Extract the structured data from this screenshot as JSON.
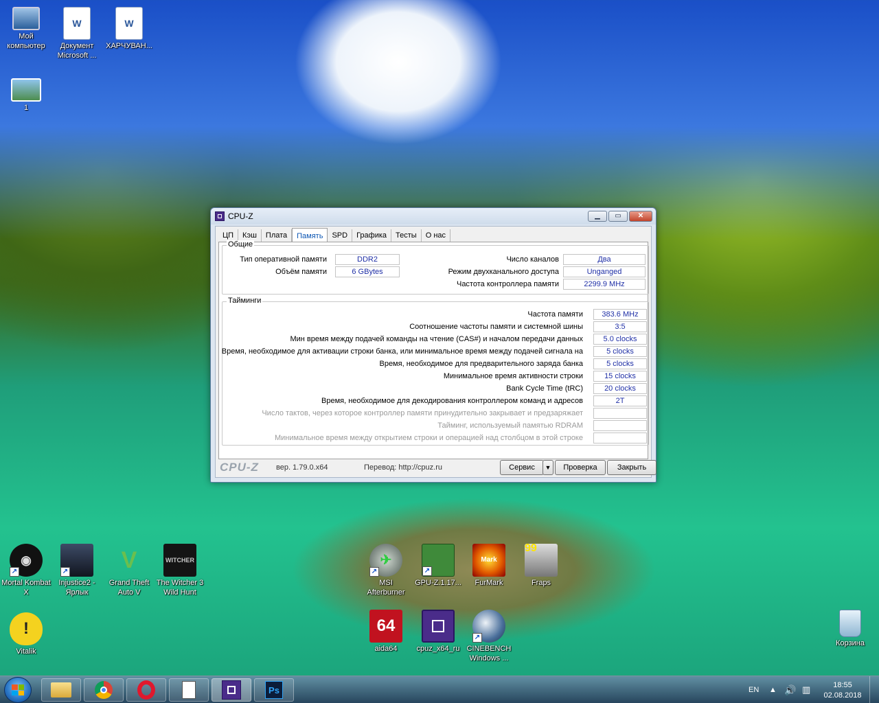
{
  "desktop": {
    "top_icons": [
      {
        "label": "Мой компьютер"
      },
      {
        "label": "Документ Microsoft ..."
      },
      {
        "label": "ХАРЧУВАН..."
      },
      {
        "label": "1"
      }
    ],
    "bottom_icons": [
      {
        "label": "Mortal Kombat X"
      },
      {
        "label": "Injustice2 - Ярлык"
      },
      {
        "label": "Grand Theft Auto V"
      },
      {
        "label": "The Witcher 3 Wild Hunt"
      },
      {
        "label": "MSI Afterburner"
      },
      {
        "label": "GPU-Z.1.17..."
      },
      {
        "label": "FurMark"
      },
      {
        "label": "Fraps"
      },
      {
        "label": "Vitalik"
      },
      {
        "label": "aida64"
      },
      {
        "label": "cpuz_x64_ru"
      },
      {
        "label": "CINEBENCH Windows ..."
      },
      {
        "label": "Корзина"
      }
    ],
    "icon_glyphs": {
      "aida": "64",
      "fraps": "99",
      "gta": "V",
      "witcher": "WITCHER",
      "furmark": "Mark",
      "photoshop": "Ps"
    }
  },
  "cpuz": {
    "title": "CPU-Z",
    "tabs": [
      "ЦП",
      "Кэш",
      "Плата",
      "Память",
      "SPD",
      "Графика",
      "Тесты",
      "О нас"
    ],
    "active_tab": "Память",
    "general": {
      "title": "Общие",
      "rows": [
        {
          "label": "Тип оперативной памяти",
          "value": "DDR2"
        },
        {
          "label": "Объём памяти",
          "value": "6 GBytes"
        },
        {
          "label": "Число каналов",
          "value": "Два"
        },
        {
          "label": "Режим двухканального доступа",
          "value": "Unganged"
        },
        {
          "label": "Частота контроллера памяти",
          "value": "2299.9 MHz"
        }
      ]
    },
    "timings": {
      "title": "Тайминги",
      "rows": [
        {
          "label": "Частота памяти",
          "value": "383.6 MHz"
        },
        {
          "label": "Соотношение частоты памяти и системной шины",
          "value": "3:5"
        },
        {
          "label": "Мин время между подачей команды на чтение (CAS#) и началом передачи данных",
          "value": "5.0 clocks"
        },
        {
          "label": "Время, необходимое для активации строки банка, или минимальное время между подачей сигнала на",
          "value": "5 clocks"
        },
        {
          "label": "Время, необходимое для предварительного заряда банка",
          "value": "5 clocks"
        },
        {
          "label": "Минимальное время активности строки",
          "value": "15 clocks"
        },
        {
          "label": "Bank Cycle Time (tRC)",
          "value": "20 clocks"
        },
        {
          "label": "Время, необходимое для декодирования контроллером команд и адресов",
          "value": "2T"
        },
        {
          "label": "Число тактов, через которое контроллер памяти принудительно закрывает и предзаряжает",
          "value": ""
        },
        {
          "label": "Тайминг, используемый памятью RDRAM",
          "value": ""
        },
        {
          "label": "Минимальное время между открытием строки и операцией над столбцом в этой строке",
          "value": ""
        }
      ]
    },
    "footer": {
      "logo": "CPU-Z",
      "version": "вер. 1.79.0.x64",
      "translation": "Перевод: http://cpuz.ru",
      "service": "Сервис",
      "dropdown": "▼",
      "validate": "Проверка",
      "close": "Закрыть"
    }
  },
  "taskbar": {
    "lang": "EN",
    "time": "18:55",
    "date": "02.08.2018"
  }
}
